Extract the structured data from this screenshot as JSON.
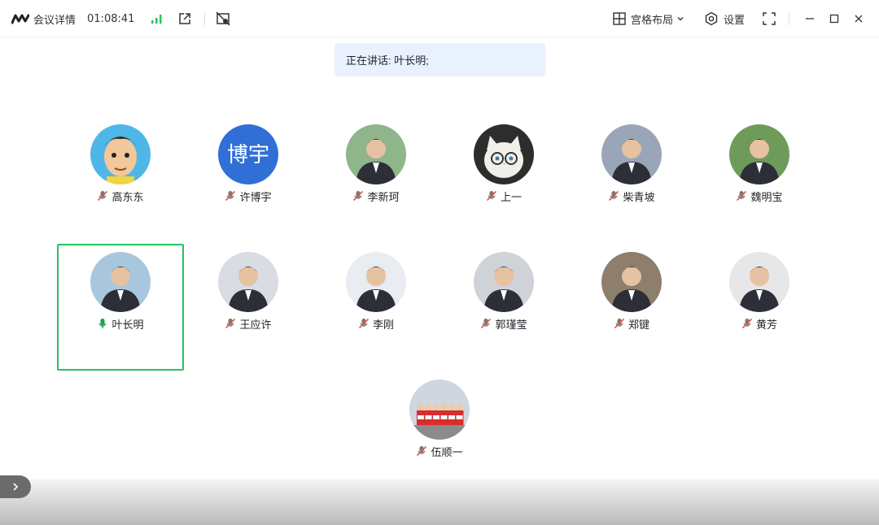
{
  "titlebar": {
    "title": "会议详情",
    "timer": "01:08:41",
    "layout_label": "宫格布局",
    "settings_label": "设置"
  },
  "banner": {
    "speaking_text": "正在讲话: 叶长明;"
  },
  "participants": [
    {
      "name": "高东东",
      "avatar": "cartoon-face",
      "mic": "muted"
    },
    {
      "name": "许博宇",
      "avatar": "text",
      "avatar_text": "博宇",
      "avatar_color": "#2f6fd6",
      "mic": "muted"
    },
    {
      "name": "李新珂",
      "avatar": "photo",
      "mic": "muted"
    },
    {
      "name": "上一",
      "avatar": "cat-photo",
      "mic": "muted"
    },
    {
      "name": "柴青坡",
      "avatar": "photo",
      "mic": "muted"
    },
    {
      "name": "魏明宝",
      "avatar": "photo",
      "mic": "muted"
    },
    {
      "name": "叶长明",
      "avatar": "photo",
      "mic": "speaking",
      "active": true
    },
    {
      "name": "王应许",
      "avatar": "photo",
      "mic": "muted"
    },
    {
      "name": "李刚",
      "avatar": "photo",
      "mic": "muted"
    },
    {
      "name": "郭瑾莹",
      "avatar": "photo",
      "mic": "muted"
    },
    {
      "name": "郑键",
      "avatar": "photo",
      "mic": "muted"
    },
    {
      "name": "黄芳",
      "avatar": "photo",
      "mic": "muted"
    },
    {
      "name": "伍顺一",
      "avatar": "group-photo",
      "mic": "muted"
    }
  ],
  "colors": {
    "active_border": "#22c55e",
    "muted_mic": "#e0584f",
    "speaking_mic": "#16a34a",
    "signal": "#22c55e",
    "banner_bg": "#e8f1fd"
  }
}
